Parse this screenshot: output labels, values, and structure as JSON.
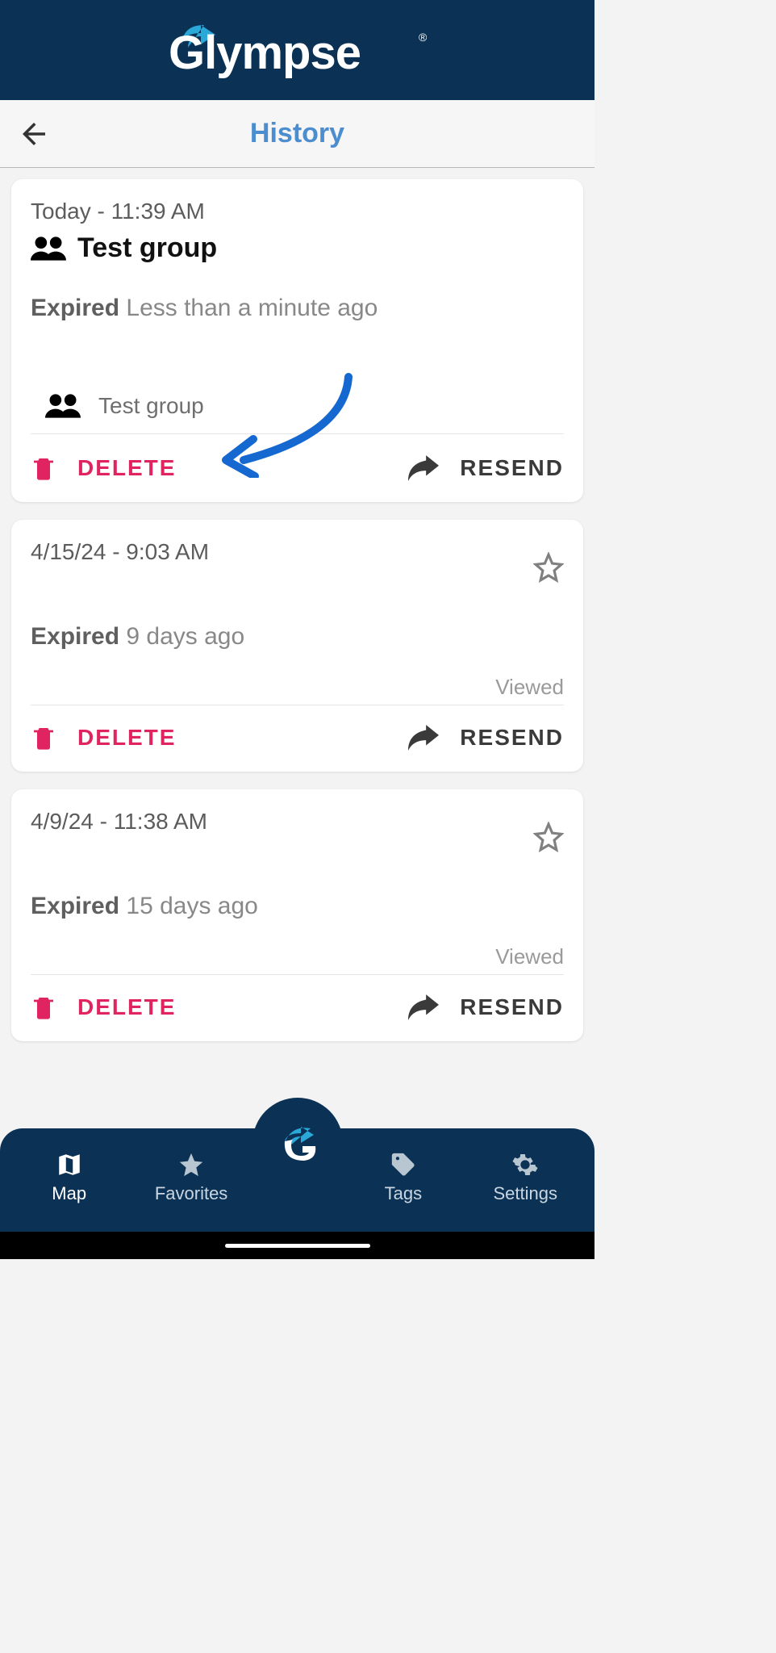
{
  "brand": {
    "name": "Glympse"
  },
  "header": {
    "title": "History"
  },
  "history_items": [
    {
      "timestamp": "Today - 11:39 AM",
      "title": "Test group",
      "has_group_icon": true,
      "has_star": false,
      "status_label": "Expired",
      "status_detail": "Less than a minute ago",
      "members": [
        {
          "name": "Test group"
        }
      ],
      "viewed_label": null,
      "actions": {
        "delete": "DELETE",
        "resend": "RESEND"
      }
    },
    {
      "timestamp": "4/15/24 - 9:03 AM",
      "title": null,
      "has_group_icon": false,
      "has_star": true,
      "status_label": "Expired",
      "status_detail": "9 days ago",
      "members": [],
      "viewed_label": "Viewed",
      "actions": {
        "delete": "DELETE",
        "resend": "RESEND"
      }
    },
    {
      "timestamp": "4/9/24 - 11:38 AM",
      "title": null,
      "has_group_icon": false,
      "has_star": true,
      "status_label": "Expired",
      "status_detail": "15 days ago",
      "members": [],
      "viewed_label": "Viewed",
      "actions": {
        "delete": "DELETE",
        "resend": "RESEND"
      }
    }
  ],
  "bottom_nav": {
    "items": [
      {
        "label": "Map",
        "icon": "map-icon",
        "active": true
      },
      {
        "label": "Favorites",
        "icon": "star-icon",
        "active": false
      },
      {
        "label": "",
        "icon": "glympse-fab-icon",
        "is_fab": true
      },
      {
        "label": "Tags",
        "icon": "tag-icon",
        "active": false
      },
      {
        "label": "Settings",
        "icon": "gear-icon",
        "active": false
      }
    ]
  },
  "colors": {
    "brand_bg": "#0b3255",
    "accent": "#4b8dcf",
    "delete": "#e0245f"
  }
}
